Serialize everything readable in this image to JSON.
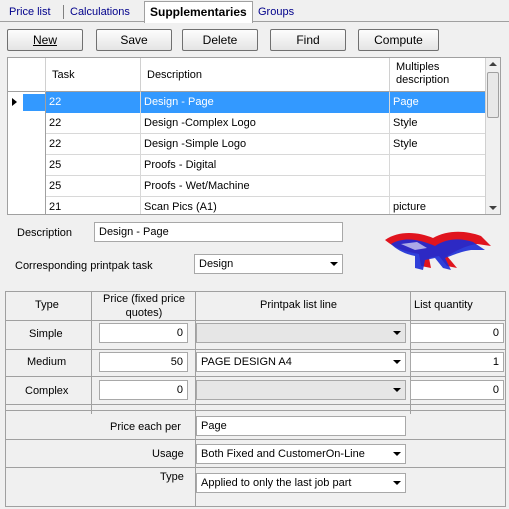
{
  "tabs": [
    "Price list",
    "Calculations",
    "Supplementaries",
    "Groups"
  ],
  "toolbar": {
    "new": "New",
    "save": "Save",
    "delete": "Delete",
    "find": "Find",
    "compute": "Compute"
  },
  "grid": {
    "headers": [
      "Task",
      "Description",
      "Multiples description"
    ],
    "rows": [
      {
        "task": "22",
        "description": "Design - Page",
        "multiples": "Page"
      },
      {
        "task": "22",
        "description": "Design -Complex Logo",
        "multiples": "Style"
      },
      {
        "task": "22",
        "description": "Design -Simple Logo",
        "multiples": "Style"
      },
      {
        "task": "25",
        "description": "Proofs - Digital",
        "multiples": ""
      },
      {
        "task": "25",
        "description": "Proofs - Wet/Machine",
        "multiples": ""
      },
      {
        "task": "21",
        "description": "Scan Pics (A1)",
        "multiples": "picture"
      }
    ]
  },
  "form": {
    "description_label": "Description",
    "description_value": "Design - Page",
    "printpak_label": "Corresponding printpak task",
    "printpak_value": "Design"
  },
  "pricing": {
    "headers": {
      "type": "Type",
      "price": "Price (fixed price quotes)",
      "line": "Printpak list line",
      "qty": "List quantity"
    },
    "rows": [
      {
        "type": "Simple",
        "price": "0",
        "line": "",
        "qty": "0"
      },
      {
        "type": "Medium",
        "price": "50",
        "line": "PAGE DESIGN A4",
        "qty": "1"
      },
      {
        "type": "Complex",
        "price": "0",
        "line": "",
        "qty": "0"
      }
    ],
    "price_each_label": "Price each per",
    "price_each_value": "Page",
    "usage_label": "Usage",
    "usage_value": "Both Fixed and CustomerOn-Line",
    "type_label": "Type",
    "type_value": "Applied to only the last job part"
  },
  "colors": {
    "selection": "#3399ff",
    "logo_red": "#e0141e",
    "logo_blue": "#1a2bd6"
  }
}
